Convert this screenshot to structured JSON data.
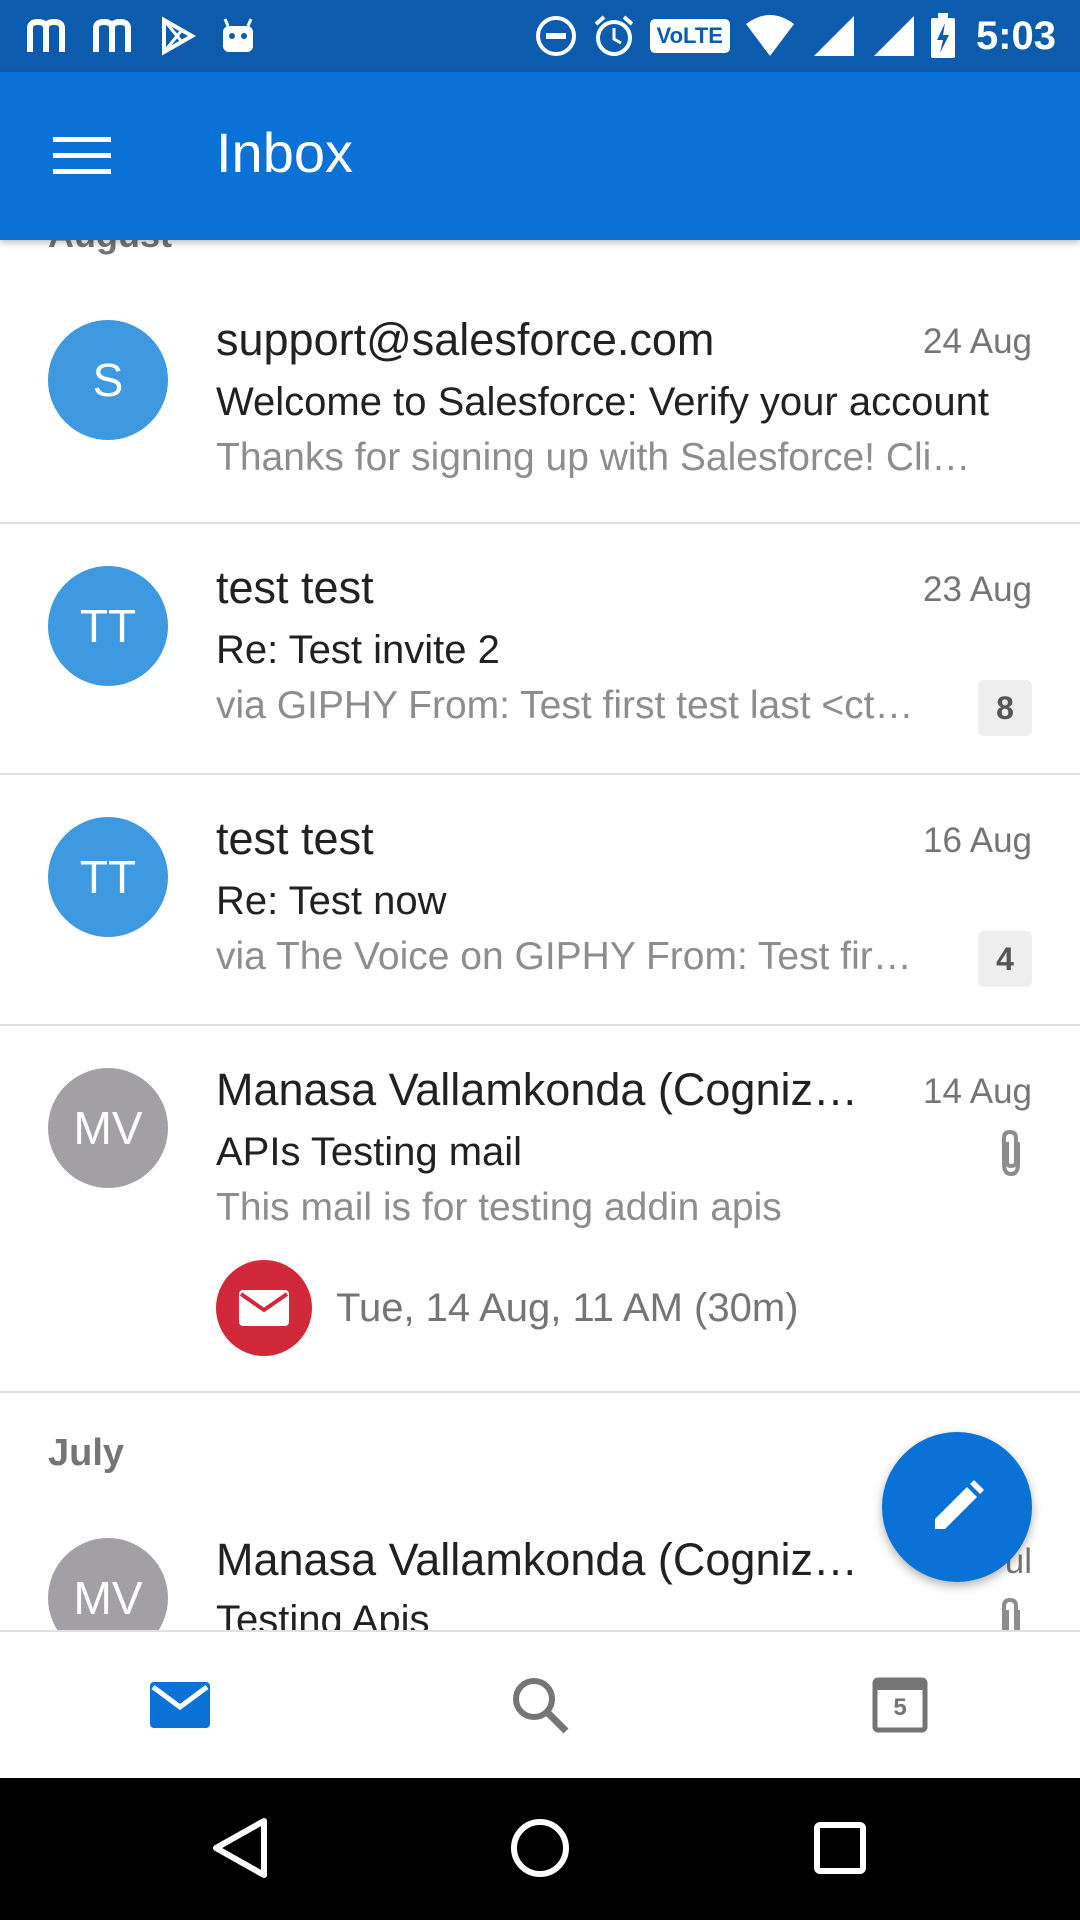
{
  "status_bar": {
    "time": "5:03",
    "volte_label": "VoLTE",
    "left_icons": [
      "m-icon",
      "m-icon",
      "play-store-icon",
      "android-icon"
    ],
    "right_icons": [
      "dnd-icon",
      "alarm-icon",
      "volte-icon",
      "wifi-icon",
      "signal-icon",
      "signal-icon",
      "battery-charging-icon"
    ]
  },
  "app_bar": {
    "title": "Inbox",
    "menu_icon": "hamburger-menu-icon"
  },
  "list": {
    "section_top": "August",
    "emails": [
      {
        "avatar": "S",
        "avatar_color": "#3e99e0",
        "sender": "support@salesforce.com",
        "date": "24 Aug",
        "subject": "Welcome to Salesforce: Verify your account",
        "preview": "Thanks for signing up with Salesforce! Cli…"
      },
      {
        "avatar": "TT",
        "avatar_color": "#3e99e0",
        "sender": "test test",
        "date": "23 Aug",
        "subject": "Re: Test invite 2",
        "preview": "via GIPHY From: Test first test last <ct…",
        "count": "8"
      },
      {
        "avatar": "TT",
        "avatar_color": "#3e99e0",
        "sender": "test test",
        "date": "16 Aug",
        "subject": "Re: Test now",
        "preview": "via The Voice on GIPHY From: Test fir…",
        "count": "4"
      },
      {
        "avatar": "MV",
        "avatar_color": "#a2a0a5",
        "sender": "Manasa Vallamkonda (Cogniz…",
        "date": "14 Aug",
        "subject": "APIs Testing mail",
        "preview": "This mail is for testing addin apis",
        "has_attachment": true,
        "event": "Tue, 14 Aug, 11 AM (30m)"
      }
    ],
    "section_july": "July",
    "july_email": {
      "avatar": "MV",
      "avatar_color": "#a2a0a5",
      "sender": "Manasa Vallamkonda (Cogniz…",
      "date_partial": "ul",
      "subject": "Testing Apis",
      "has_attachment": true
    }
  },
  "fab": {
    "icon": "pencil-compose-icon"
  },
  "bottom_nav": {
    "items": [
      {
        "icon": "mail-icon",
        "active": true
      },
      {
        "icon": "search-icon",
        "active": false
      },
      {
        "icon": "calendar-icon",
        "active": false,
        "calendar_day": "5"
      }
    ]
  },
  "colors": {
    "primary": "#0a72d6",
    "status_bar": "#0c5bad",
    "avatar_blue": "#3e99e0",
    "avatar_gray": "#a2a0a5",
    "event_red": "#d1293a"
  }
}
